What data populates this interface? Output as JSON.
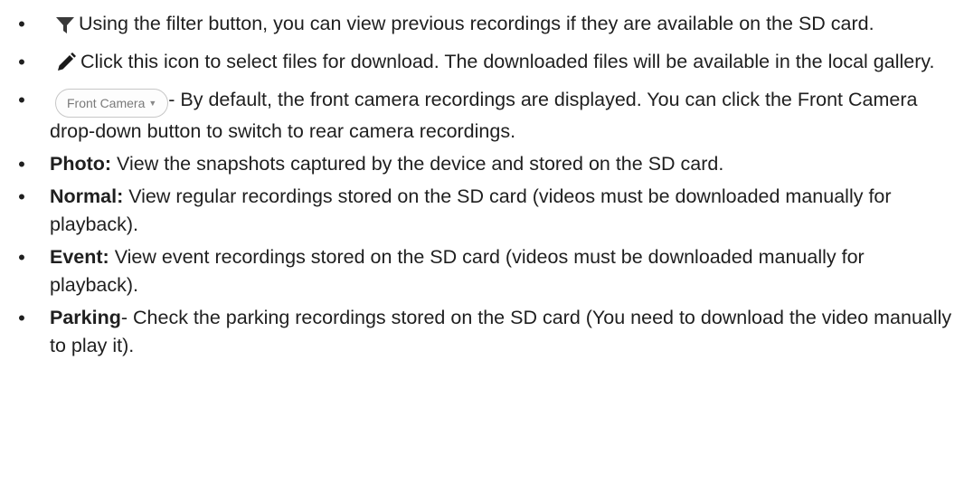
{
  "items": [
    {
      "icon": "filter-icon",
      "text": "Using the filter button, you can view previous recordings if they are available on the SD card."
    },
    {
      "icon": "pencil-icon",
      "text": "Click this icon to select files for download. The downloaded files will be available in the local gallery."
    },
    {
      "pill_label": "Front Camera",
      "icon": "caret-down-icon",
      "text": "- By default, the front camera recordings are displayed. You can click the Front Camera drop-down button to switch to rear camera recordings."
    },
    {
      "term": "Photo:",
      "text": " View the snapshots captured by the device and stored on the SD card."
    },
    {
      "term": "Normal:",
      "text": " View regular recordings stored on the SD card (videos must be downloaded manually for playback)."
    },
    {
      "term": "Event:",
      "text": " View event recordings stored on the SD card (videos must be downloaded manually for playback)."
    },
    {
      "term": "Parking",
      "text": "- Check the parking recordings stored on the SD card (You need to download the video manually to play it)."
    }
  ],
  "bullet_char": "•"
}
